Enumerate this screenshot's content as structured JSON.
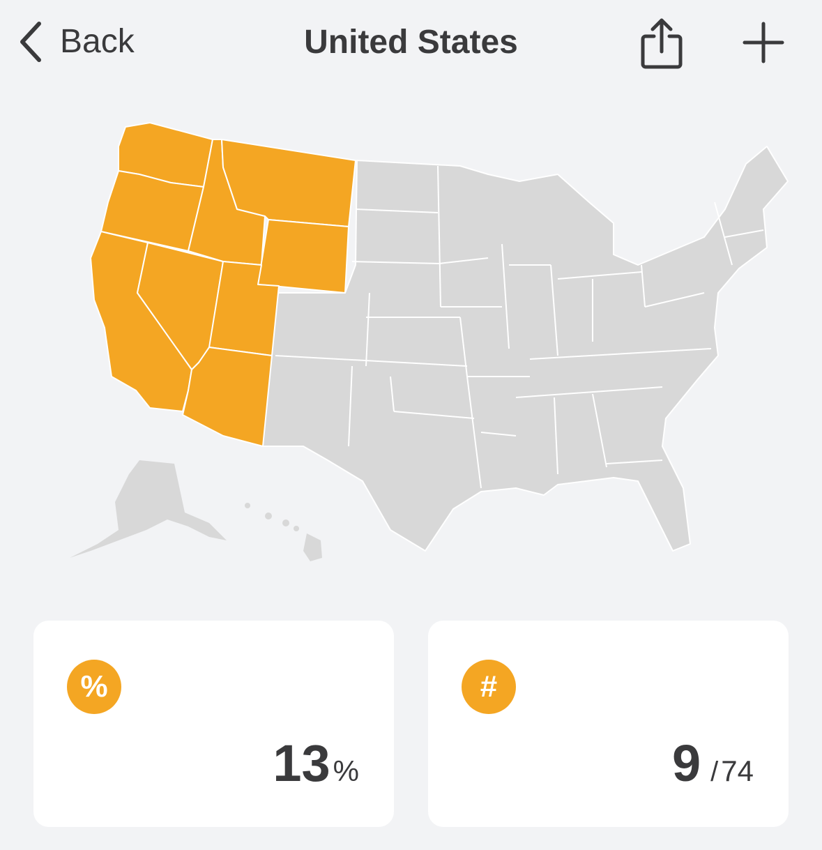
{
  "nav": {
    "back_label": "Back",
    "title": "United States",
    "share_icon": "share-icon",
    "add_icon": "plus-icon"
  },
  "map": {
    "highlight_color": "#F4A623",
    "base_color": "#D8D8D8",
    "visited_states": [
      "Washington",
      "Oregon",
      "California",
      "Idaho",
      "Nevada",
      "Montana",
      "Wyoming",
      "Utah",
      "Arizona"
    ]
  },
  "stats": {
    "percent": {
      "icon": "%",
      "value": "13",
      "unit": "%"
    },
    "count": {
      "icon": "#",
      "value": "9",
      "separator": "/",
      "total": "74"
    }
  }
}
